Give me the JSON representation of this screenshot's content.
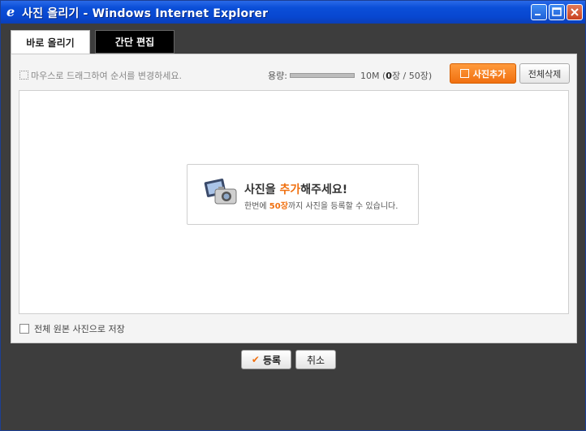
{
  "window": {
    "title": "사진 올리기 - Windows Internet Explorer",
    "icon": "ie-icon"
  },
  "tabs": [
    {
      "label": "바로 올리기",
      "active": true
    },
    {
      "label": "간단 편집",
      "active": false
    }
  ],
  "toolbar": {
    "hint": "마우스로 드래그하여 순서를 변경하세요.",
    "capacity_label": "용량:",
    "capacity_used_fraction": 0,
    "capacity_size": "10M (",
    "capacity_count": "0",
    "capacity_rest": "장 / 50장)",
    "add_label": "사진추가",
    "delete_all_label": "전체삭제"
  },
  "notice": {
    "title_pre": "사진을 ",
    "title_hl": "추가",
    "title_post": "해주세요!",
    "sub_pre": "한번에 ",
    "sub_hl": "50장",
    "sub_post": "까지 사진을 등록할 수 있습니다."
  },
  "save_option": {
    "label": "전체 원본 사진으로 저장",
    "checked": false
  },
  "footer": {
    "register_label": "등록",
    "cancel_label": "취소"
  },
  "colors": {
    "accent": "#f07010",
    "titlebar": "#0a4fd8"
  }
}
